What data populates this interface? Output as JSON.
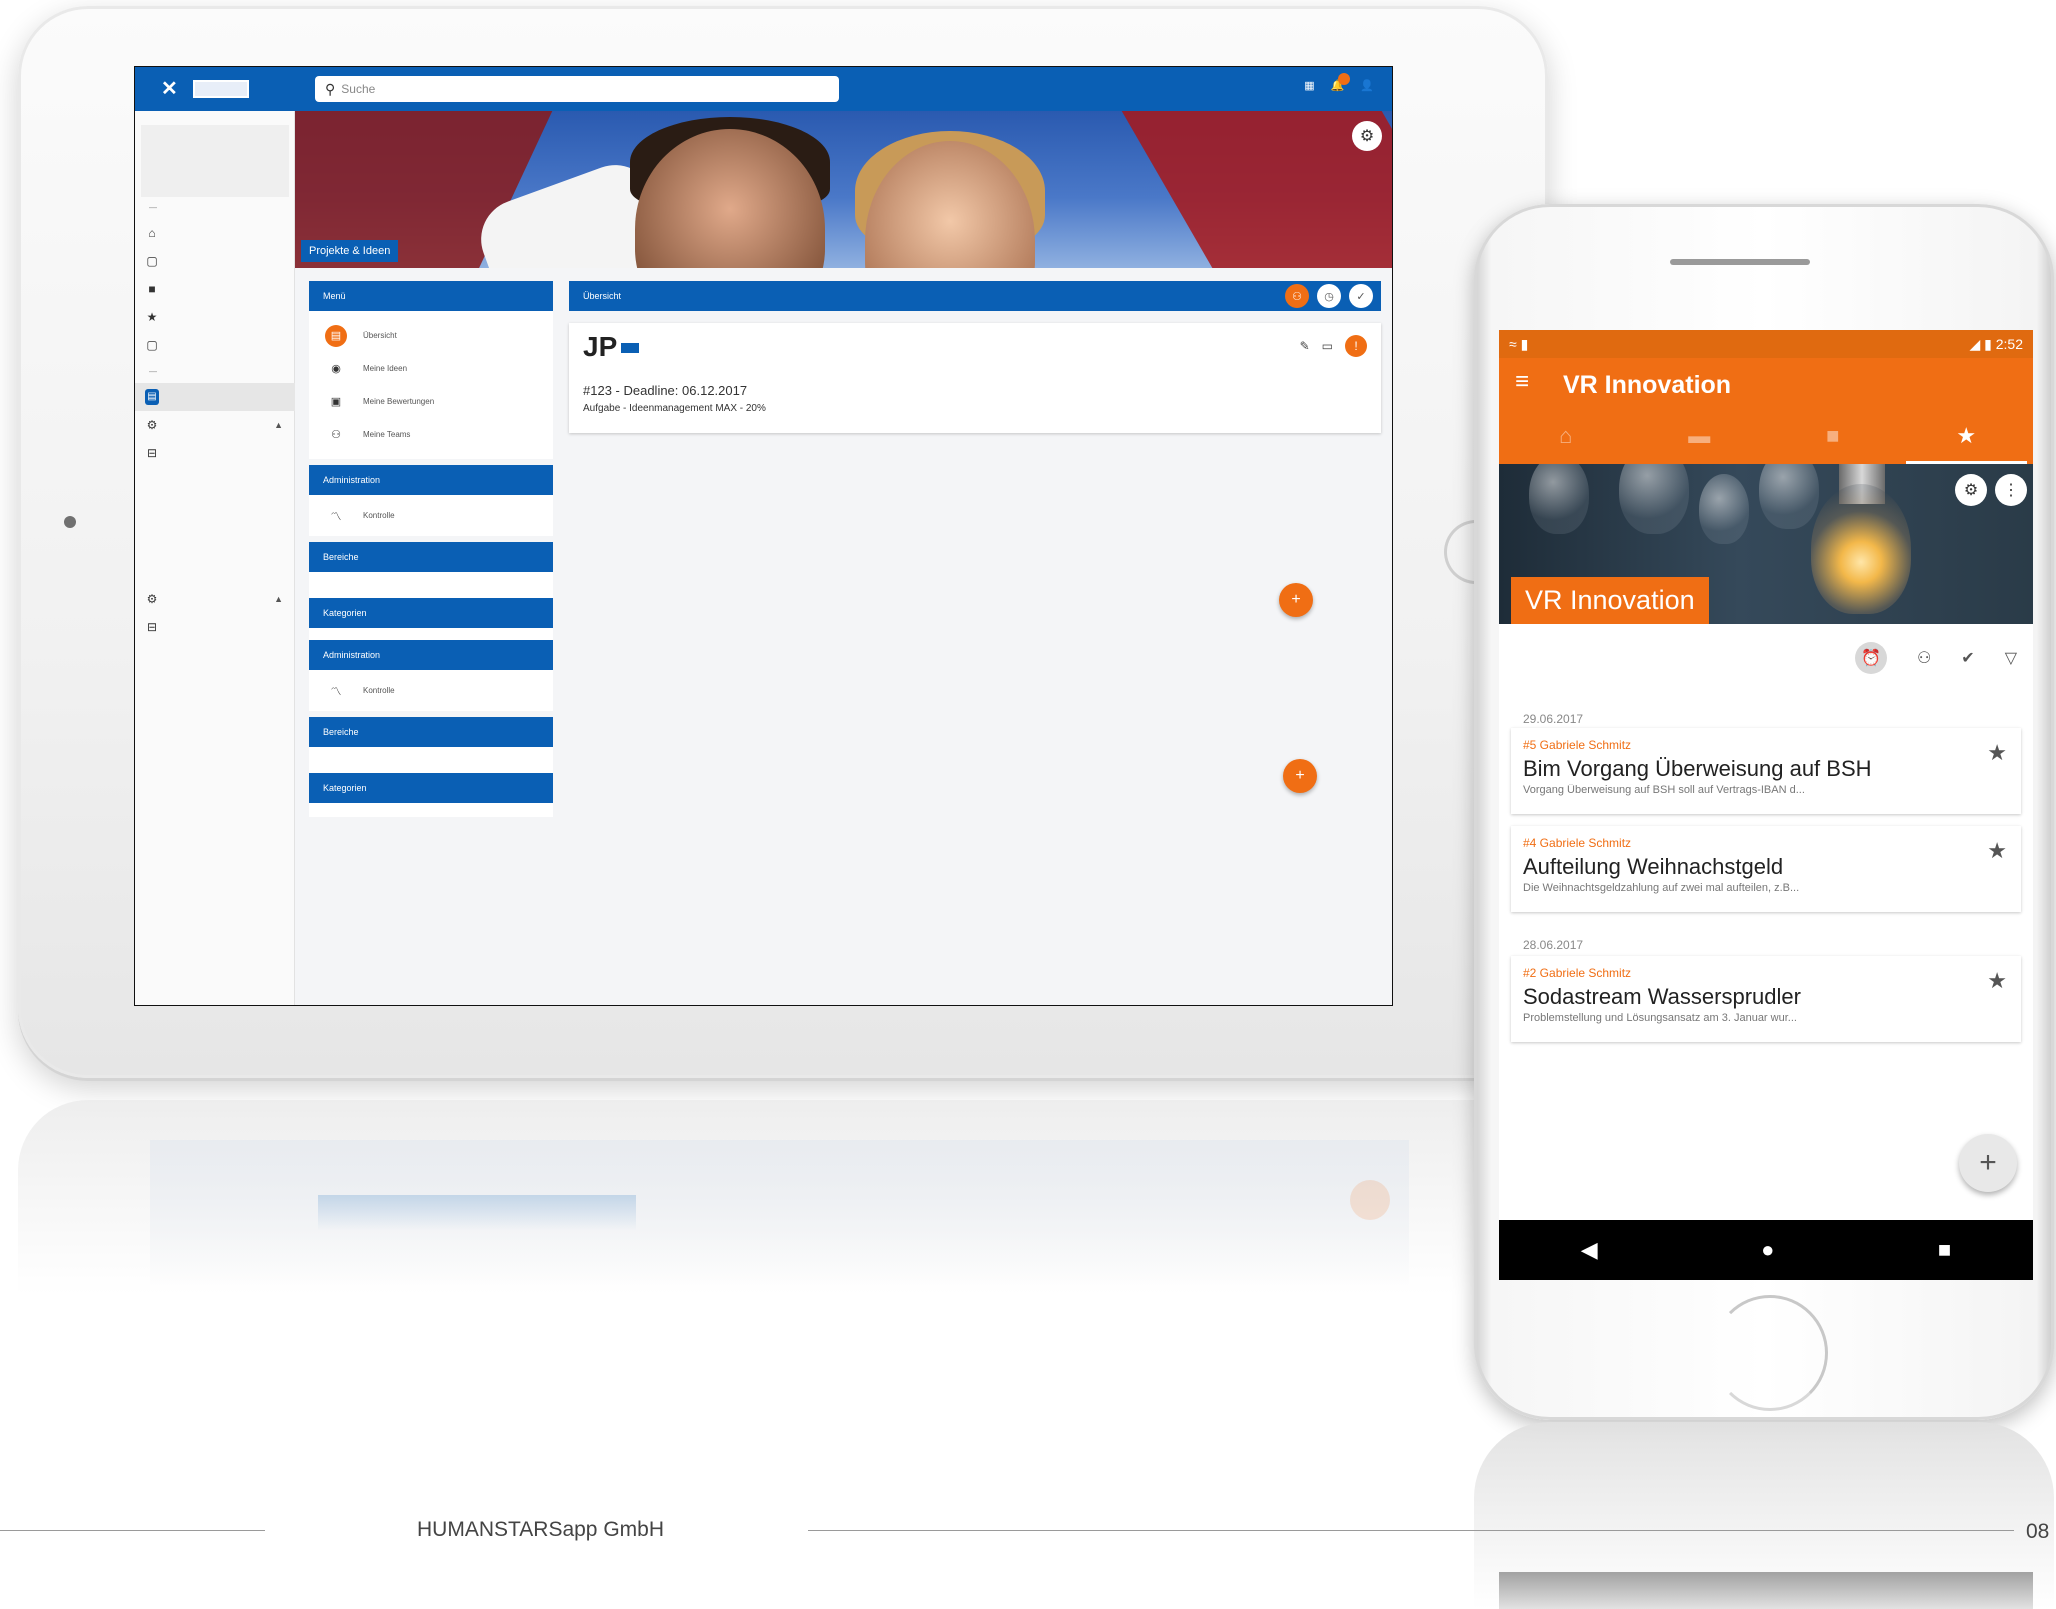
{
  "footer": {
    "company": "HUMANSTARSapp GmbH",
    "page": "08"
  },
  "colors": {
    "brand_blue": "#0a5fb4",
    "accent_orange": "#f06e14"
  },
  "tablet": {
    "search_placeholder": "Suche",
    "hero_label": "Projekte & Ideen",
    "menu": {
      "header": "Menü",
      "items": [
        {
          "label": "Übersicht",
          "icon": "overview-icon"
        },
        {
          "label": "Meine Ideen",
          "icon": "idea-icon"
        },
        {
          "label": "Meine Bewertungen",
          "icon": "rating-icon"
        },
        {
          "label": "Meine Teams",
          "icon": "team-icon"
        }
      ],
      "sections": [
        {
          "header": "Administration",
          "item": "Kontrolle"
        },
        {
          "header": "Bereiche"
        },
        {
          "header": "Kategorien"
        },
        {
          "header": "Administration",
          "item": "Kontrolle"
        },
        {
          "header": "Bereiche"
        },
        {
          "header": "Kategorien"
        }
      ]
    },
    "overview": {
      "header": "Übersicht",
      "card": {
        "initials": "JP",
        "title": "#123 - Deadline: 06.12.2017",
        "subtitle": "Aufgabe - Ideenmanagement MAX - 20%"
      }
    }
  },
  "phone": {
    "status_time": "2:52",
    "app_title": "VR Innovation",
    "banner_title": "VR Innovation",
    "groups": [
      {
        "date": "29.06.2017",
        "items": [
          {
            "meta": "#5 Gabriele Schmitz",
            "title": "Bim Vorgang Überweisung auf BSH",
            "desc": "Vorgang Überweisung auf BSH soll auf Vertrags-IBAN d..."
          },
          {
            "meta": "#4 Gabriele Schmitz",
            "title": "Aufteilung Weihnachstgeld",
            "desc": "Die Weihnachtsgeldzahlung auf zwei mal aufteilen, z.B..."
          }
        ]
      },
      {
        "date": "28.06.2017",
        "items": [
          {
            "meta": "#2 Gabriele Schmitz",
            "title": "Sodastream Wassersprudler",
            "desc": "Problemstellung und Lösungsansatz am 3. Januar wur..."
          }
        ]
      }
    ],
    "fab_icon": "+"
  }
}
